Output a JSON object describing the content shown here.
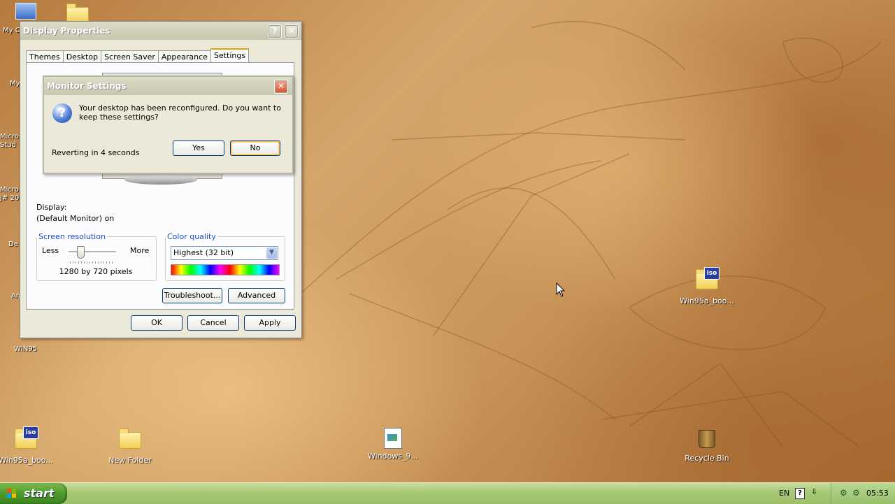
{
  "desktop": {
    "icons": [
      {
        "label": "My C",
        "kind": "computer"
      },
      {
        "label": "My",
        "kind": "generic"
      },
      {
        "label": "Micros Stud",
        "kind": "generic"
      },
      {
        "label": "Micros J# 20",
        "kind": "generic"
      },
      {
        "label": "De",
        "kind": "generic"
      },
      {
        "label": "An",
        "kind": "generic"
      },
      {
        "label": "WIN95",
        "kind": "folder"
      },
      {
        "label": "Win95a_boo...",
        "kind": "iso"
      },
      {
        "label": "New Folder",
        "kind": "folder"
      },
      {
        "label": "Windows_9...",
        "kind": "image-file"
      },
      {
        "label": "Recycle Bin",
        "kind": "recycle-bin"
      },
      {
        "label": "Win95a_boo...",
        "kind": "iso"
      }
    ],
    "iso_badge": "iso"
  },
  "display_properties": {
    "title": "Display Properties",
    "tabs": [
      "Themes",
      "Desktop",
      "Screen Saver",
      "Appearance",
      "Settings"
    ],
    "active_tab": "Settings",
    "display_label": "Display:",
    "display_value": "(Default Monitor) on",
    "screen_resolution": {
      "legend": "Screen resolution",
      "less": "Less",
      "more": "More",
      "value_text": "1280 by 720 pixels",
      "slider_position": 0.25
    },
    "color_quality": {
      "legend": "Color quality",
      "selected": "Highest (32 bit)"
    },
    "buttons": {
      "troubleshoot": "Troubleshoot...",
      "advanced": "Advanced",
      "ok": "OK",
      "cancel": "Cancel",
      "apply": "Apply"
    }
  },
  "monitor_settings": {
    "title": "Monitor Settings",
    "message": "Your desktop has been reconfigured.  Do you want to keep these settings?",
    "countdown": "Reverting in 4 seconds",
    "yes": "Yes",
    "no": "No"
  },
  "taskbar": {
    "start_label": "start",
    "language": "EN",
    "clock": "05:53"
  },
  "colors": {
    "xp_blue": "#003c74",
    "tab_highlight": "#e6a200",
    "taskbar_green": "#a9c977",
    "start_green": "#4e9a2a"
  }
}
